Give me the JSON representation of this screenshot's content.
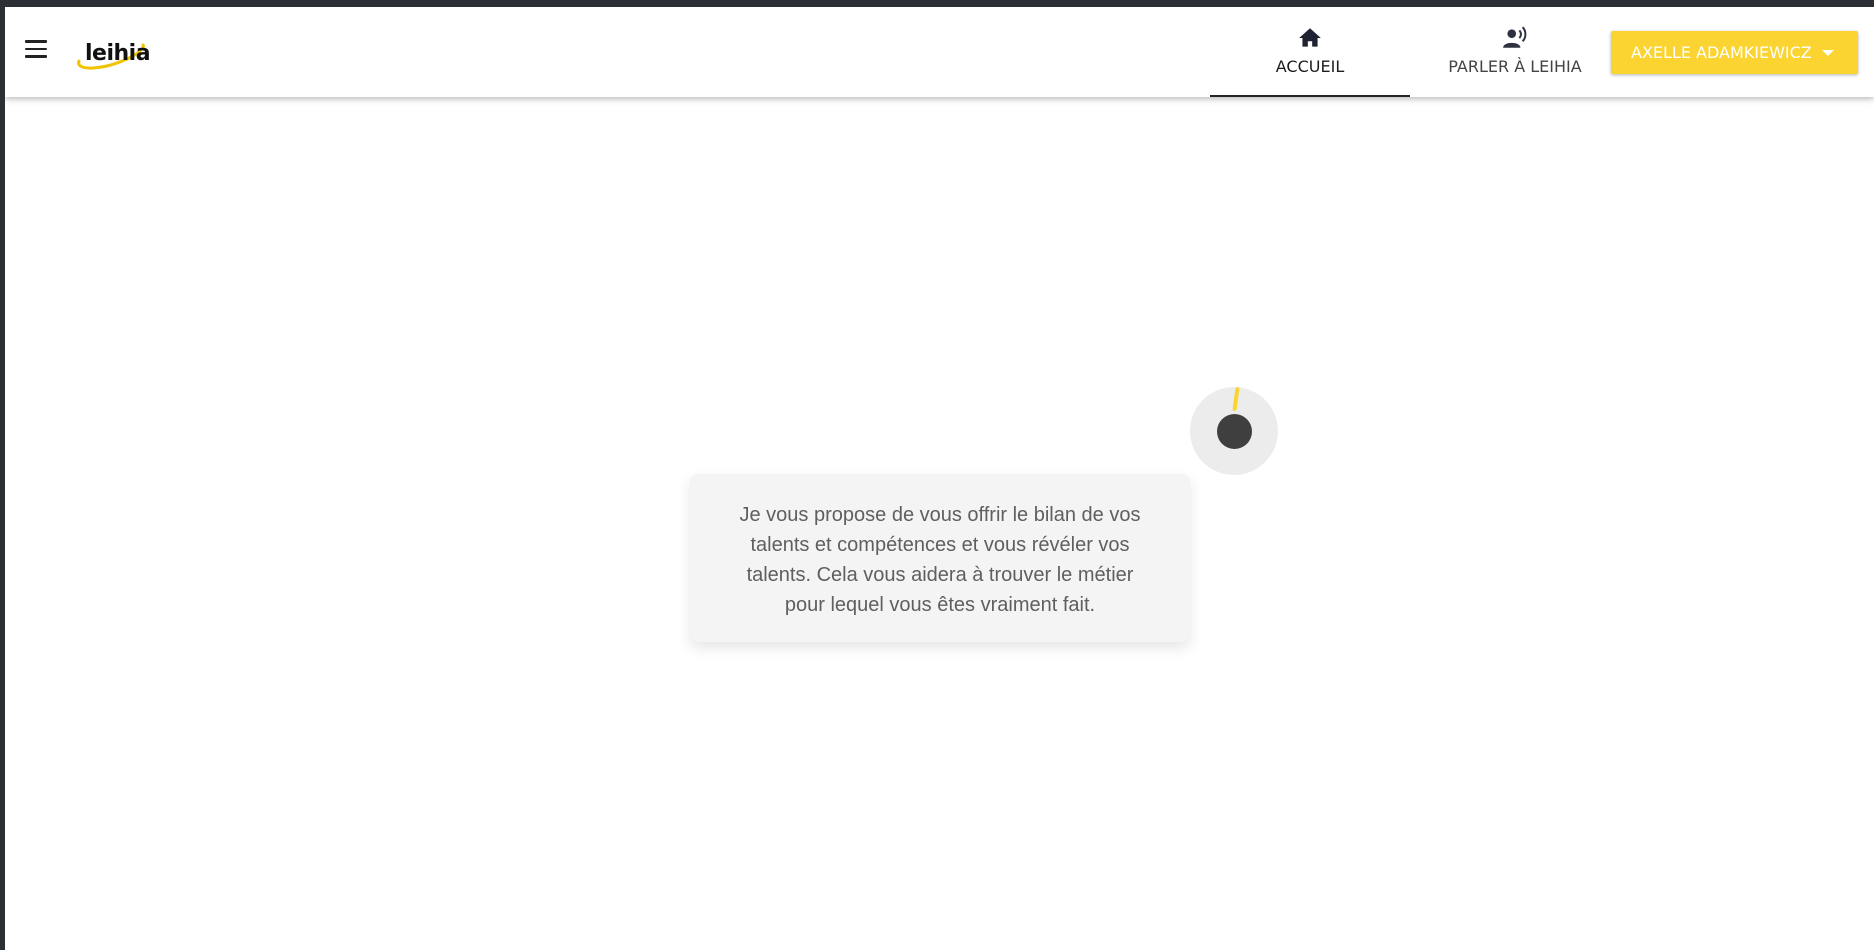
{
  "header": {
    "logo_text": "leihia",
    "nav": {
      "home": {
        "label": "ACCUEIL",
        "icon": "home-icon",
        "active": true
      },
      "talk": {
        "label": "PARLER À LEIHIA",
        "icon": "voice-icon",
        "active": false
      }
    },
    "user_menu": {
      "label": "AXELLE ADAMKIEWICZ",
      "icon": "caret-down-icon"
    }
  },
  "assistant": {
    "avatar_icon": "assistant-avatar-icon",
    "message": "Je vous propose de vous offrir le bilan de vos talents et compétences et vous révéler vos talents. Cela vous aidera à trouver le métier pour lequel vous êtes vraiment fait."
  },
  "colors": {
    "accent": "#fbd431",
    "bubble_bg": "#f4f4f4",
    "avatar_dot": "#3f3f3f"
  }
}
